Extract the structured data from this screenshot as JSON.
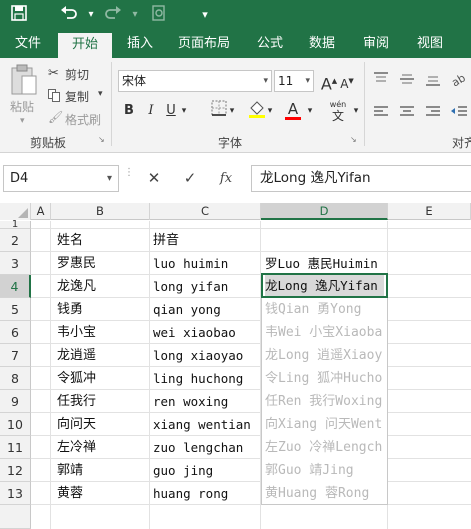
{
  "quick_access": {
    "save_icon": "save-icon",
    "undo_icon": "undo-icon",
    "redo_icon": "redo-icon",
    "customize": "▾"
  },
  "tabs": [
    "文件",
    "开始",
    "插入",
    "页面布局",
    "公式",
    "数据",
    "审阅",
    "视图"
  ],
  "active_tab": "开始",
  "ribbon": {
    "clipboard": {
      "paste": "粘贴",
      "cut": "剪切",
      "copy": "复制",
      "format_painter": "格式刷",
      "group_label": "剪贴板"
    },
    "font": {
      "font_name": "宋体",
      "font_size": "11",
      "bold": "B",
      "italic": "I",
      "underline": "U",
      "font_color_letter": "A",
      "wen": "wén",
      "wen_char": "文",
      "group_label": "字体",
      "font_color": "#ff0000"
    },
    "alignment": {
      "group_label": "对齐"
    }
  },
  "formula_bar": {
    "name_box": "D4",
    "cancel": "✕",
    "enter": "✓",
    "fx": "fx",
    "value": "龙Long 逸凡Yifan"
  },
  "grid": {
    "columns": [
      "A",
      "B",
      "C",
      "D",
      "E"
    ],
    "selected_column": "D",
    "rows": [
      "1",
      "2",
      "3",
      "4",
      "5",
      "6",
      "7",
      "8",
      "9",
      "10",
      "11",
      "12",
      "13"
    ],
    "selected_row": "4",
    "header_row": {
      "B": "姓名",
      "C": "拼音"
    },
    "data": [
      {
        "row": "3",
        "B": "罗惠民",
        "C": "luo huimin",
        "D": "罗Luo 惠民Huimin"
      },
      {
        "row": "4",
        "B": "龙逸凡",
        "C": "long yifan",
        "D": "龙Long 逸凡Yifan"
      },
      {
        "row": "5",
        "B": "钱勇",
        "C": "qian yong",
        "D": "钱Qian 勇Yong"
      },
      {
        "row": "6",
        "B": "韦小宝",
        "C": "wei xiaobao",
        "D": "韦Wei 小宝Xiaoba"
      },
      {
        "row": "7",
        "B": "龙逍遥",
        "C": "long xiaoyao",
        "D": "龙Long 逍遥Xiaoy"
      },
      {
        "row": "8",
        "B": "令狐冲",
        "C": "ling huchong",
        "D": "令Ling 狐冲Hucho"
      },
      {
        "row": "9",
        "B": "任我行",
        "C": "ren woxing",
        "D": "任Ren 我行Woxing"
      },
      {
        "row": "10",
        "B": "向问天",
        "C": "xiang wentian",
        "D": "向Xiang 问天Went"
      },
      {
        "row": "11",
        "B": "左冷禅",
        "C": "zuo lengchan",
        "D": "左Zuo 冷禅Lengch"
      },
      {
        "row": "12",
        "B": "郭靖",
        "C": "guo jing",
        "D": "郭Guo 靖Jing"
      },
      {
        "row": "13",
        "B": "黄蓉",
        "C": "huang rong",
        "D": "黄Huang 蓉Rong"
      }
    ]
  },
  "colors": {
    "excel_green": "#217346",
    "ghost_text": "#b9b9b9"
  }
}
